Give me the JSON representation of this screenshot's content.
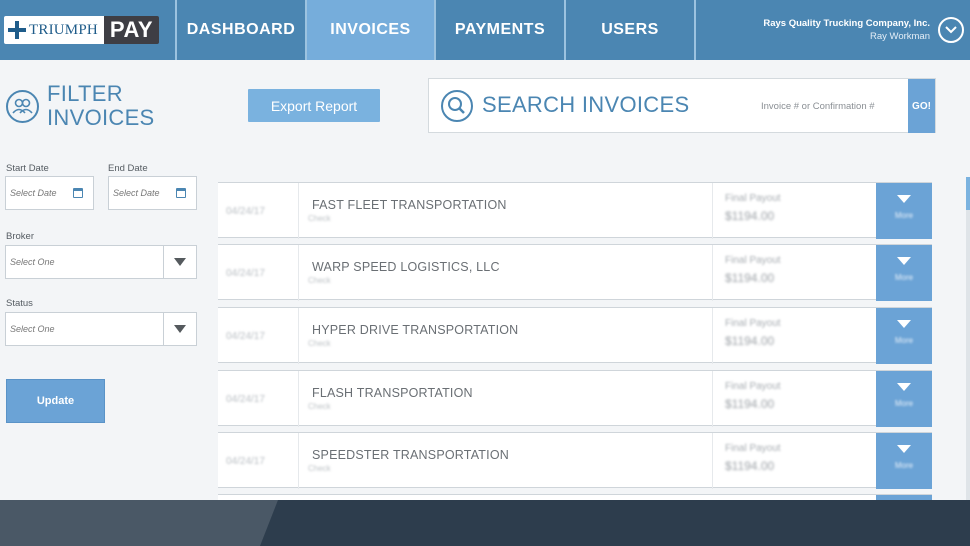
{
  "brand": {
    "logo_text": "TRIUMPH",
    "logo_suffix": "PAY"
  },
  "nav": {
    "tabs": [
      {
        "label": "DASHBOARD",
        "active": false
      },
      {
        "label": "INVOICES",
        "active": true
      },
      {
        "label": "PAYMENTS",
        "active": false
      },
      {
        "label": "USERS",
        "active": false
      }
    ]
  },
  "account": {
    "company": "Rays Quality Trucking Company, Inc.",
    "user": "Ray Workman",
    "icon": "chevron-down-icon"
  },
  "filter": {
    "title_line1": "FILTER",
    "title_line2": "INVOICES",
    "start_label": "Start Date",
    "end_label": "End Date",
    "date_placeholder": "Select Date",
    "broker_label": "Broker",
    "status_label": "Status",
    "select_placeholder": "Select One",
    "update_label": "Update"
  },
  "export_label": "Export Report",
  "search": {
    "title": "SEARCH INVOICES",
    "placeholder": "Invoice # or Confirmation #",
    "go_label": "GO!"
  },
  "invoices": [
    {
      "date": "04/24/17",
      "company": "FAST FLEET TRANSPORTATION",
      "method": "Check",
      "payout_label": "Final Payout",
      "payout": "$1194.00",
      "more": "More"
    },
    {
      "date": "04/24/17",
      "company": "WARP SPEED LOGISTICS, LLC",
      "method": "Check",
      "payout_label": "Final Payout",
      "payout": "$1194.00",
      "more": "More"
    },
    {
      "date": "04/24/17",
      "company": "HYPER DRIVE TRANSPORTATION",
      "method": "Check",
      "payout_label": "Final Payout",
      "payout": "$1194.00",
      "more": "More"
    },
    {
      "date": "04/24/17",
      "company": "FLASH TRANSPORTATION",
      "method": "Check",
      "payout_label": "Final Payout",
      "payout": "$1194.00",
      "more": "More"
    },
    {
      "date": "04/24/17",
      "company": "SPEEDSTER TRANSPORTATION",
      "method": "Check",
      "payout_label": "Final Payout",
      "payout": "$1194.00",
      "more": "More"
    }
  ],
  "colors": {
    "primary": "#4b86b2",
    "accent": "#6ba3d6",
    "active_tab": "#76addb",
    "footer": "#2d3d4d"
  }
}
